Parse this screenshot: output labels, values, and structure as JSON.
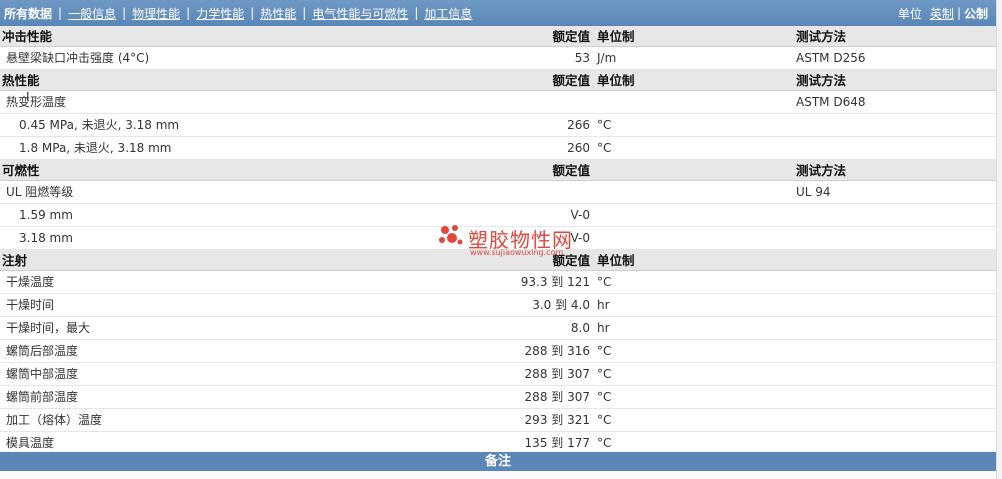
{
  "nav": {
    "tabs": [
      {
        "label": "所有数据",
        "active": true
      },
      {
        "label": "一般信息"
      },
      {
        "label": "物理性能"
      },
      {
        "label": "力学性能"
      },
      {
        "label": "热性能"
      },
      {
        "label": "电气性能与可燃性"
      },
      {
        "label": "加工信息"
      }
    ],
    "units_label": "单位",
    "unit_imperial": "英制",
    "unit_separator": "|",
    "unit_metric": "公制"
  },
  "sections": [
    {
      "title": "冲击性能",
      "value_header": "额定值",
      "unit_header": "单位制",
      "method_header": "测试方法",
      "rows": [
        {
          "name": "悬壁梁缺口冲击强度 (4°C)",
          "value": "53",
          "unit": "J/m",
          "method": "ASTM D256"
        }
      ]
    },
    {
      "title": "热性能",
      "value_header": "额定值",
      "unit_header": "单位制",
      "method_header": "测试方法",
      "rows": [
        {
          "name": "热变形温度",
          "value": "",
          "unit": "",
          "method": "ASTM D648"
        },
        {
          "name": "0.45 MPa, 未退火, 3.18 mm",
          "sub": true,
          "value": "266",
          "unit": "°C",
          "method": ""
        },
        {
          "name": "1.8 MPa, 未退火, 3.18 mm",
          "sub": true,
          "value": "260",
          "unit": "°C",
          "method": ""
        }
      ]
    },
    {
      "title": "可燃性",
      "value_header": "额定值",
      "unit_header": "",
      "method_header": "测试方法",
      "rows": [
        {
          "name": "UL 阻燃等级",
          "value": "",
          "unit": "",
          "method": "UL 94"
        },
        {
          "name": "1.59 mm",
          "sub": true,
          "value": "V-0",
          "unit": "",
          "method": ""
        },
        {
          "name": "3.18 mm",
          "sub": true,
          "value": "V-0",
          "unit": "",
          "method": ""
        }
      ]
    },
    {
      "title": "注射",
      "value_header": "额定值",
      "unit_header": "单位制",
      "method_header": "",
      "rows": [
        {
          "name": "干燥温度",
          "value": "93.3 到  121",
          "unit": "°C",
          "method": ""
        },
        {
          "name": "干燥时间",
          "value": "3.0 到  4.0",
          "unit": "hr",
          "method": ""
        },
        {
          "name": "干燥时间，最大",
          "value": "8.0",
          "unit": "hr",
          "method": ""
        },
        {
          "name": "螺筒后部温度",
          "value": "288 到  316",
          "unit": "°C",
          "method": ""
        },
        {
          "name": "螺筒中部温度",
          "value": "288 到  307",
          "unit": "°C",
          "method": ""
        },
        {
          "name": "螺筒前部温度",
          "value": "288 到  307",
          "unit": "°C",
          "method": ""
        },
        {
          "name": "加工（熔体）温度",
          "value": "293 到  321",
          "unit": "°C",
          "method": ""
        },
        {
          "name": "模具温度",
          "value": "135 到  177",
          "unit": "°C",
          "method": ""
        }
      ]
    }
  ],
  "footer": {
    "title": "备注"
  },
  "watermark": {
    "text": "塑胶物性网",
    "sub": "www.sujiaowuxing.com",
    "color": "#e0483e"
  },
  "colors": {
    "header_bar": "#5a87b8",
    "section_bg": "#e7e7e7"
  }
}
